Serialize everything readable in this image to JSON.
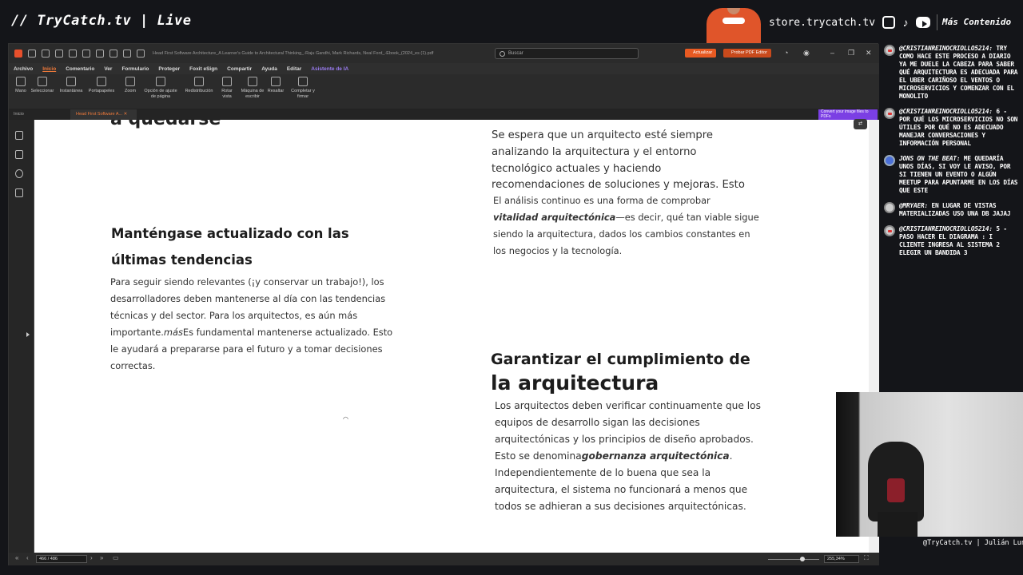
{
  "stream": {
    "brand": "// TryCatch.tv | Live",
    "store": "store.trycatch.tv",
    "more": "Más Contenido",
    "social_icons": [
      "instagram-icon",
      "tiktok-icon",
      "youtube-icon"
    ],
    "cam_name": "@TryCatch.tv | Julián Luna"
  },
  "app": {
    "title": "Head First Software Architecture_A Learner's Guide to Architectural Thinking_-Raju Gandhi, Mark Richards, Neal Ford_-Ebook_(2024_es (1).pdf",
    "search_placeholder": "Buscar",
    "update_label": "Actualizar",
    "try_label": "Probar PDF Editor",
    "menu": [
      "Archivo",
      "Inicio",
      "Comentario",
      "Ver",
      "Formulario",
      "Proteger",
      "Foxit eSign",
      "Compartir",
      "Ayuda",
      "Editar",
      "Asistente de IA"
    ],
    "active_menu": "Inicio",
    "ribbon": [
      {
        "label": "Mano",
        "icon": "hand-icon"
      },
      {
        "label": "Seleccionar",
        "icon": "select-icon"
      },
      {
        "label": "Instantánea",
        "icon": "snapshot-icon"
      },
      {
        "label": "Portapapeles",
        "icon": "clipboard-icon"
      },
      {
        "label": "Zoom",
        "icon": "zoom-icon"
      },
      {
        "label": "Opción de ajuste de página",
        "icon": "fit-page-icon"
      },
      {
        "label": "Redistribución",
        "icon": "reflow-icon"
      },
      {
        "label": "Rotar vista",
        "icon": "rotate-icon"
      },
      {
        "label": "Máquina de escribir",
        "icon": "typewriter-icon"
      },
      {
        "label": "Resaltar",
        "icon": "highlight-icon"
      },
      {
        "label": "Completar y firmar",
        "icon": "fill-sign-icon"
      }
    ],
    "tabs": [
      "Inicio",
      "Head First Software A..."
    ],
    "promo": "Convert your image files to PDFs",
    "page_number": "466 / 486",
    "zoom": "255,34%",
    "accent": "#e85a22"
  },
  "document": {
    "left_heading_1": "Manténgase actualizado con las",
    "left_heading_2": "últimas tendencias",
    "left_lines": [
      "Para seguir siendo relevantes (¡y conservar un trabajo!), los",
      "desarrolladores deben mantenerse al día con las tendencias",
      "técnicas y del sector. Para los arquitectos, es aún más"
    ],
    "left_line4_italic": "más",
    "left_line4_a": "importante.",
    "left_line4_b": "Es fundamental mantenerse actualizado. Esto",
    "left_lines_tail": [
      "le ayudará a prepararse para el futuro y a tomar decisiones",
      "correctas."
    ],
    "right_cut_heading": "a quedarse",
    "right_top_lines": [
      "Se espera que un arquitecto esté siempre",
      "analizando la arquitectura y el entorno",
      "tecnológico actuales y haciendo",
      "recomendaciones de soluciones y mejoras. Esto"
    ],
    "right_top_small": "El análisis continuo es una forma de comprobar",
    "right_vital_bold": "vitalidad arquitectónica",
    "right_vital_rest": "—es decir, qué tan viable sigue",
    "right_top_tail": [
      "siendo la arquitectura, dados los cambios constantes en",
      "los negocios y la tecnología."
    ],
    "right_heading_1": "Garantizar el cumplimiento de",
    "right_heading_2": "la arquitectura",
    "right_bottom_lines": [
      "Los arquitectos deben verificar continuamente que los",
      "equipos de desarrollo sigan las decisiones",
      "arquitectónicas y los principios de diseño aprobados."
    ],
    "right_gov_a": "Esto se denomina",
    "right_gov_bold": "gobernanza arquitectónica",
    "right_gov_end": ".",
    "right_bottom_tail": [
      "Independientemente de lo buena que sea la",
      "arquitectura, el sistema no funcionará a menos que",
      "todos se adhieran a sus decisiones arquitectónicas."
    ]
  },
  "chat": [
    {
      "user": "@CRISTIANREINOCRIOLLO5214:",
      "text": "TRY COMO HACE ESTE PROCESO A DIARIO YA ME DUELE LA CABEZA PARA SABER QUÉ ARQUITECTURA ES ADECUADA PARA EL UBER CARIÑOSO EL VENTOS O MICROSERVICIOS Y COMENZAR CON EL MONOLITO",
      "badge": "red"
    },
    {
      "user": "@CRISTIANREINOCRIOLLO5214:",
      "text": "6 - POR QUÉ LOS MICROSERVICIOS NO SON ÚTILES POR QUÉ NO ES ADECUADO MANEJAR CONVERSACIONES Y INFORMACIÓN PERSONAL",
      "badge": "red"
    },
    {
      "user": "JONS ON THE BEAT:",
      "text": "ME QUEDARÍA UNOS DÍAS, SI VOY LE AVISO, POR SI TIENEN UN EVENTO O ALGÚN MEETUP PARA APUNTARME EN LOS DÍAS QUE ESTE",
      "badge": "blue"
    },
    {
      "user": "@MRYAER:",
      "text": "EN LUGAR DE VISTAS MATERIALIZADAS USO UNA DB JAJAJ",
      "badge": "grey"
    },
    {
      "user": "@CRISTIANREINOCRIOLLO5214:",
      "text": "5 - PASO HACER EL DIAGRAMA : I CLIENTE INGRESA AL SISTEMA 2 ELEGIR UN BANDIDA 3",
      "badge": "red"
    }
  ]
}
